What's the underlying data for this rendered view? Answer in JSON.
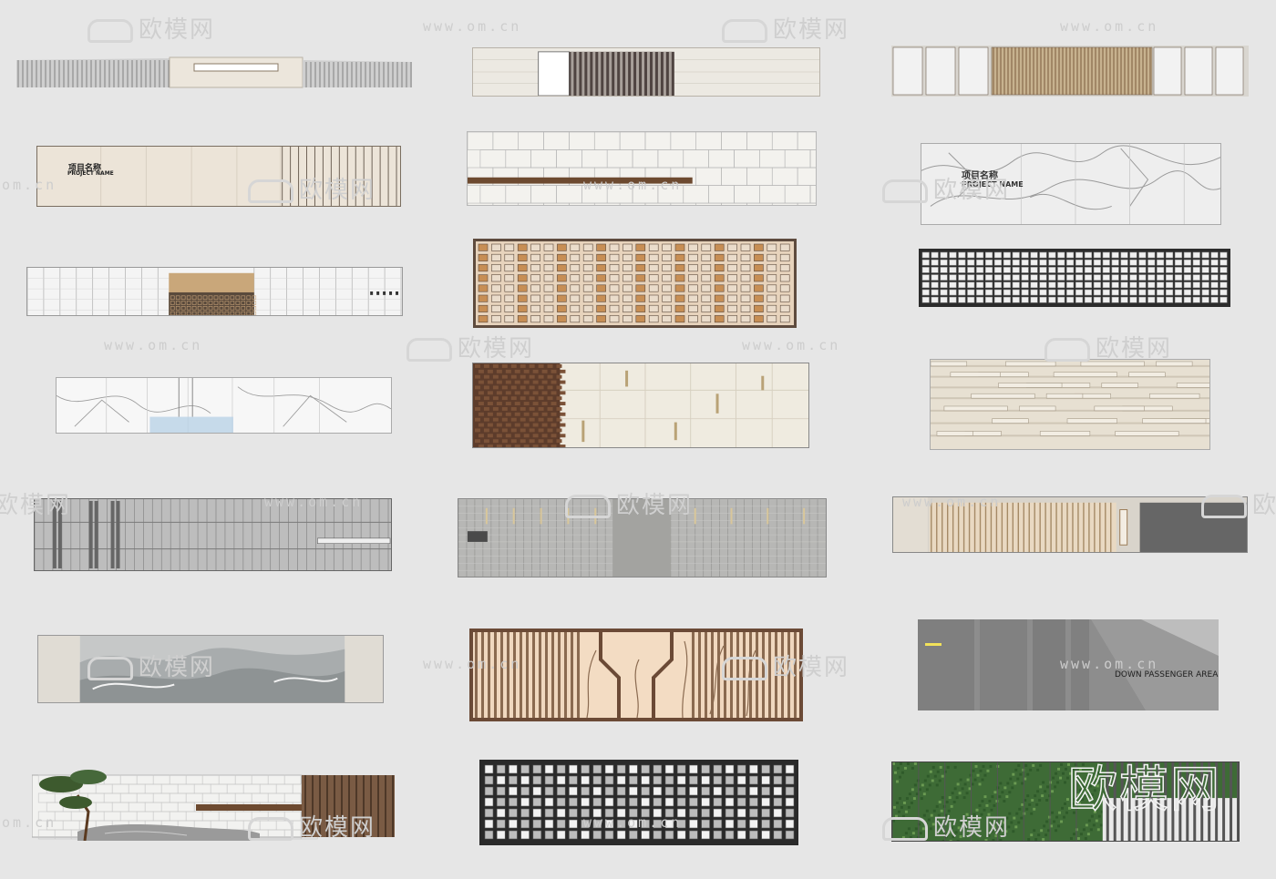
{
  "watermark": {
    "brand": "欧模网",
    "url": "www.om.cn",
    "url_edge": "om.cn",
    "edge_brand": "欧模网"
  },
  "panels": [
    {
      "id": "p1"
    },
    {
      "id": "p2"
    },
    {
      "id": "p3"
    },
    {
      "id": "p4",
      "title_cn": "项目名称",
      "title_en": "PROJECT NAME"
    },
    {
      "id": "p5"
    },
    {
      "id": "p6",
      "title_cn": "项目名称",
      "title_en": "PROJECT NAME"
    },
    {
      "id": "p7"
    },
    {
      "id": "p8"
    },
    {
      "id": "p9"
    },
    {
      "id": "p10"
    },
    {
      "id": "p11"
    },
    {
      "id": "p12"
    },
    {
      "id": "p13"
    },
    {
      "id": "p14"
    },
    {
      "id": "p15"
    },
    {
      "id": "p16"
    },
    {
      "id": "p17"
    },
    {
      "id": "p18",
      "sign": "DOWN PASSENGER AREA"
    },
    {
      "id": "p19"
    },
    {
      "id": "p20"
    },
    {
      "id": "p21"
    }
  ],
  "colors": {
    "background": "#e6e6e6",
    "stone": "#e9e4da",
    "wood": "#8a5a3a",
    "metal": "#6f6f6f"
  }
}
